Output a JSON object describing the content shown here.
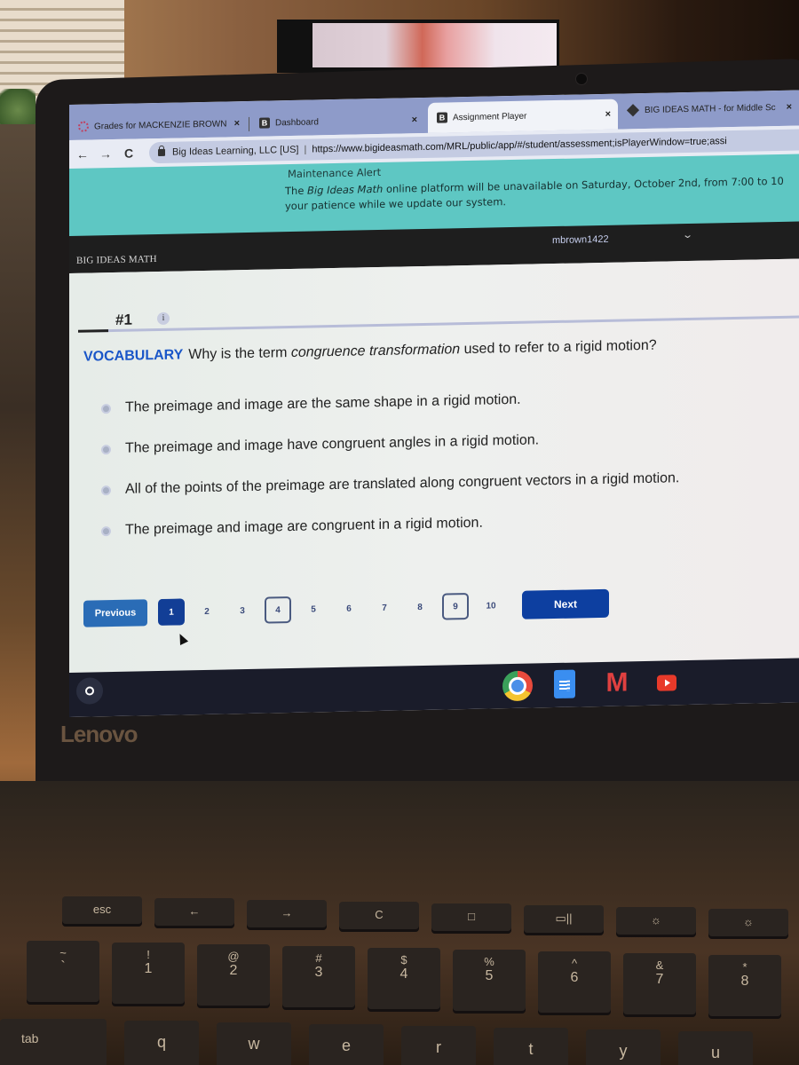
{
  "browser": {
    "tabs": [
      {
        "title": "Grades for MACKENZIE BROWN",
        "icon": "grades-icon",
        "active": false
      },
      {
        "title": "Dashboard",
        "icon": "big-ideas-b-icon",
        "active": false
      },
      {
        "title": "Assignment Player",
        "icon": "big-ideas-b-icon",
        "active": true
      },
      {
        "title": "BIG IDEAS MATH - for Middle Sc",
        "icon": "big-ideas-math-icon",
        "active": false
      }
    ],
    "close_glyph": "×",
    "nav": {
      "back": "←",
      "forward": "→",
      "reload": "C"
    },
    "site_identity": "Big Ideas Learning, LLC [US]",
    "separator": "|",
    "url": "https://www.bigideasmath.com/MRL/public/app/#/student/assessment;isPlayerWindow=true;assi"
  },
  "banner": {
    "title": "Maintenance Alert",
    "text_prefix": "The ",
    "text_italic": "Big Ideas Math",
    "text_line1_rest": " online platform will be unavailable on Saturday, October 2nd, from 7:00 to 10",
    "text_line2": "your patience while we update our system."
  },
  "app_header": {
    "brand": "BIG IDEAS MATH",
    "username": "mbrown1422",
    "menu_glyph": "⌄"
  },
  "question": {
    "number": "#1",
    "info_glyph": "i",
    "label": "VOCABULARY",
    "prompt_before": "Why is the term ",
    "prompt_italic": "congruence transformation",
    "prompt_after": " used to refer to a rigid motion?",
    "choices": [
      "The preimage and image are the same shape in a rigid motion.",
      "The preimage and image have congruent angles in a rigid motion.",
      "All of the points of the preimage are translated along congruent vectors in a rigid motion.",
      "The preimage and image are congruent in a rigid motion."
    ]
  },
  "pagination": {
    "previous_label": "Previous",
    "next_label": "Next",
    "pages": [
      "1",
      "2",
      "3",
      "4",
      "5",
      "6",
      "7",
      "8",
      "9",
      "10"
    ],
    "current_page": "1",
    "flagged_pages": [
      "4",
      "9"
    ]
  },
  "shelf": {
    "apps": [
      "chrome",
      "google-docs",
      "gmail",
      "youtube"
    ]
  },
  "hardware": {
    "brand": "Lenovo",
    "keys_top_row": [
      "esc",
      "←",
      "→",
      "C",
      "□",
      "▭||",
      "☼",
      "☼"
    ],
    "keys_number_row": [
      {
        "top": "~",
        "bot": "`"
      },
      {
        "top": "!",
        "bot": "1"
      },
      {
        "top": "@",
        "bot": "2"
      },
      {
        "top": "#",
        "bot": "3"
      },
      {
        "top": "$",
        "bot": "4"
      },
      {
        "top": "%",
        "bot": "5"
      },
      {
        "top": "^",
        "bot": "6"
      },
      {
        "top": "&",
        "bot": "7"
      },
      {
        "top": "*",
        "bot": "8"
      }
    ],
    "keys_letter_row": [
      "tab",
      "q",
      "w",
      "e",
      "r",
      "t",
      "y",
      "u"
    ]
  }
}
